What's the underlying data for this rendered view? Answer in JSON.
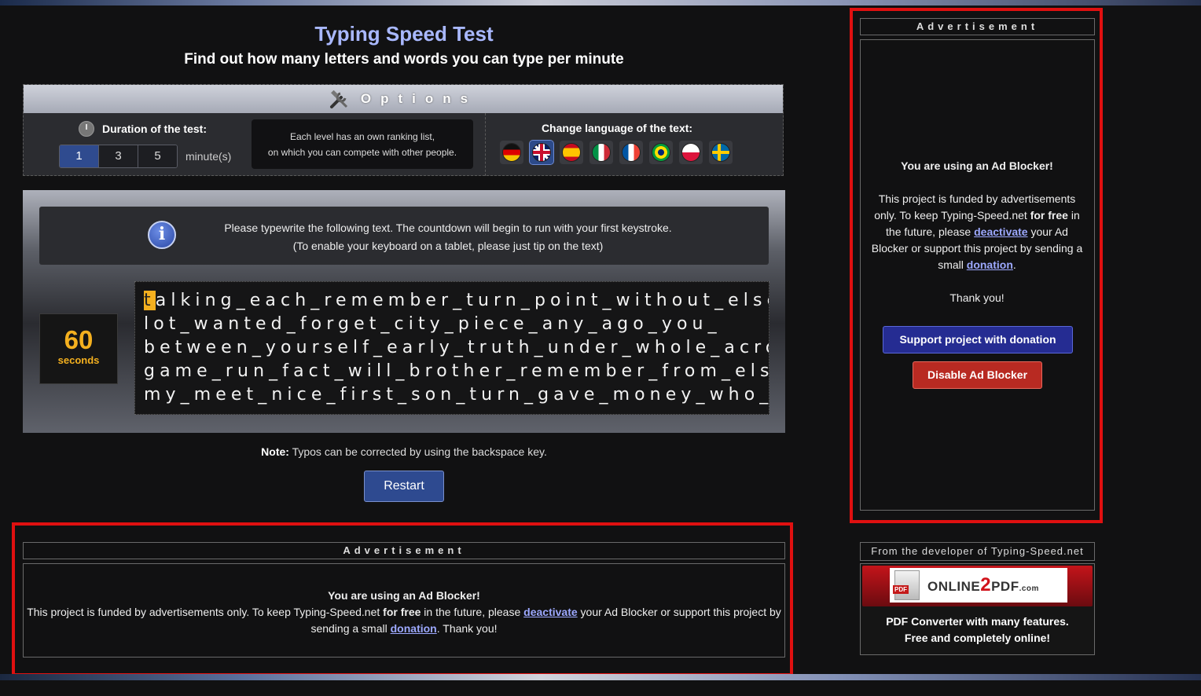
{
  "header": {
    "title": "Typing Speed Test",
    "subtitle": "Find out how many letters and words you can type per minute"
  },
  "options": {
    "title": "Options",
    "duration_label": "Duration of the test:",
    "durations": [
      "1",
      "3",
      "5"
    ],
    "selected_duration": "1",
    "minutes_label": "minute(s)",
    "ranking_note_line1": "Each level has an own ranking list,",
    "ranking_note_line2": "on which you can compete with other people.",
    "language_label": "Change language of the text:",
    "languages": [
      "German",
      "English",
      "Spanish",
      "Italian",
      "French",
      "Portuguese (Brazil)",
      "Polish",
      "Swedish"
    ],
    "selected_language": "English"
  },
  "test": {
    "info_line1": "Please typewrite the following text. The countdown will begin to run with your first keystroke.",
    "info_line2": "(To enable your keyboard on a tablet, please just tip on the text)",
    "timer_value": "60",
    "timer_unit": "seconds",
    "current_char": "t",
    "lines": [
      "alking_each_remember_turn_point_without_else_",
      "lot_wanted_forget_city_piece_any_ago_you_",
      "between_yourself_early_truth_under_whole_across_",
      "game_run_fact_will_brother_remember_from_else_",
      "my_meet_nice_first_son_turn_gave_money_who_"
    ],
    "note_label": "Note:",
    "note_text": " Typos can be corrected by using the backspace key.",
    "restart_label": "Restart"
  },
  "bottom_ad": {
    "title": "Advertisement",
    "heading": "You are using an Ad Blocker!",
    "text_1": "This project is funded by advertisements only. To keep Typing-Speed.net ",
    "text_free": "for free",
    "text_2": " in the future, please ",
    "link_deactivate": "deactivate",
    "text_3": " your Ad Blocker or support this project by sending a small ",
    "link_donation": "donation",
    "text_4": ". Thank you!"
  },
  "right_ad": {
    "title": "Advertisement",
    "heading": "You are using an Ad Blocker!",
    "text_1": "This project is funded by advertisements only. To keep Typing-Speed.net ",
    "text_free": "for free",
    "text_2": " in the future, please ",
    "link_deactivate": "deactivate",
    "text_3": " your Ad Blocker or support this project by sending a small ",
    "link_donation": "donation",
    "text_4": ".",
    "thanks": "Thank you!",
    "donate_button": "Support project with donation",
    "disable_button": "Disable Ad Blocker"
  },
  "developer": {
    "title": "From the developer of Typing-Speed.net",
    "logo_pdf": "PDF",
    "logo_online": "ONLINE",
    "logo_two": "2",
    "logo_pdf_word": "PDF",
    "logo_com": ".com",
    "line1": "PDF Converter with many features.",
    "line2": "Free and completely online!"
  },
  "colors": {
    "accent_blue": "#2e4a90",
    "timer_orange": "#f4b01f",
    "frame_red": "#e01010",
    "title_blue": "#a9b8ff"
  }
}
